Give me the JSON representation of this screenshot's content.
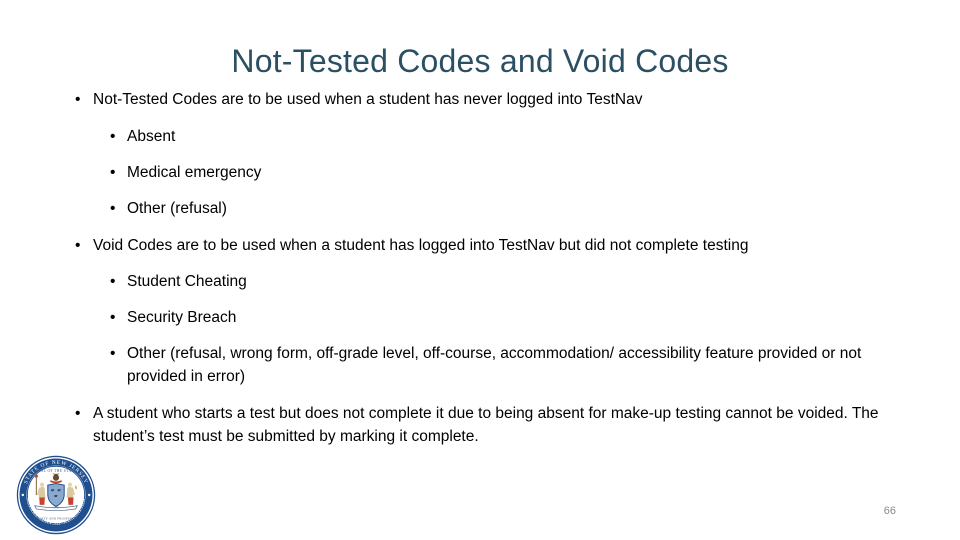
{
  "slide": {
    "title": "Not-Tested Codes and Void Codes",
    "page_number": "66",
    "bullets": [
      {
        "level": 1,
        "marker": "•",
        "text": "Not-Tested Codes are to be used when a student has never logged into TestNav"
      },
      {
        "level": 2,
        "marker": "•",
        "text": "Absent"
      },
      {
        "level": 2,
        "marker": "•",
        "text": "Medical emergency"
      },
      {
        "level": 2,
        "marker": "•",
        "text": "Other (refusal)"
      },
      {
        "level": 1,
        "marker": "•",
        "text": "Void Codes are to be used when a student has logged into TestNav but did not complete testing"
      },
      {
        "level": 2,
        "marker": "•",
        "text": "Student Cheating"
      },
      {
        "level": 2,
        "marker": "•",
        "text": "Security Breach"
      },
      {
        "level": 2,
        "marker": "•",
        "text": "Other (refusal, wrong form, off-grade level, off-course, accommodation/ accessibility feature provided or not provided in error)"
      },
      {
        "level": 1,
        "marker": "•",
        "text": "A student who starts a test but does not complete it due to being absent for make-up testing cannot be voided. The student’s test must be submitted by marking it complete."
      }
    ]
  },
  "logo": {
    "name": "nj-doe-seal",
    "outer_text_top": "STATE OF NEW JERSEY",
    "outer_text_bottom": "DEPARTMENT OF EDUCATION",
    "ring_color": "#1f4f8f",
    "shield_color": "#8aa9cc",
    "accent_color": "#c6442e"
  },
  "colors": {
    "title": "#2b4f63",
    "body_text": "#000000",
    "page_number": "#8a8a8a",
    "background": "#ffffff"
  }
}
